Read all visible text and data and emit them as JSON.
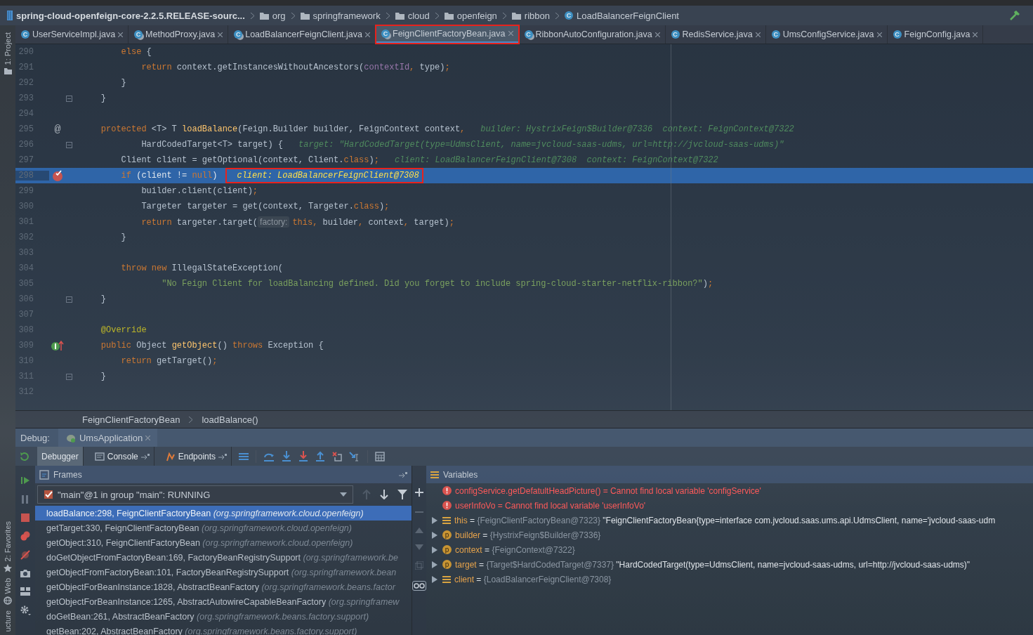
{
  "navbar": {
    "project": "spring-cloud-openfeign-core-2.2.5.RELEASE-sourc...",
    "crumbs": [
      {
        "kind": "folder",
        "label": "org"
      },
      {
        "kind": "folder",
        "label": "springframework"
      },
      {
        "kind": "folder",
        "label": "cloud"
      },
      {
        "kind": "folder",
        "label": "openfeign"
      },
      {
        "kind": "folder",
        "label": "ribbon"
      },
      {
        "kind": "class",
        "letter": "C",
        "label": "LoadBalancerFeignClient"
      }
    ]
  },
  "left_strip": [
    {
      "label": "1: Project"
    },
    {
      "label": "2: Favorites"
    },
    {
      "label": "Web"
    },
    {
      "label": "ucture"
    }
  ],
  "tabs": [
    {
      "letter": "C",
      "label": "UserServiceImpl.java",
      "locked": false,
      "selected": false,
      "marked": false
    },
    {
      "letter": "C",
      "label": "MethodProxy.java",
      "locked": true,
      "selected": false,
      "marked": false
    },
    {
      "letter": "C",
      "label": "LoadBalancerFeignClient.java",
      "locked": true,
      "selected": false,
      "marked": false
    },
    {
      "letter": "C",
      "label": "FeignClientFactoryBean.java",
      "locked": true,
      "selected": true,
      "marked": true
    },
    {
      "letter": "C",
      "label": "RibbonAutoConfiguration.java",
      "locked": true,
      "selected": false,
      "marked": false
    },
    {
      "letter": "C",
      "label": "RedisService.java",
      "locked": false,
      "selected": false,
      "marked": false
    },
    {
      "letter": "C",
      "label": "UmsConfigService.java",
      "locked": false,
      "selected": false,
      "marked": false
    },
    {
      "letter": "C",
      "label": "FeignConfig.java",
      "locked": false,
      "selected": false,
      "marked": false
    }
  ],
  "editor": {
    "lines": [
      {
        "number": "290",
        "tokens": [
          {
            "kind": "keyword",
            "text": "        else"
          },
          {
            "kind": "plain",
            "text": " {"
          }
        ]
      },
      {
        "number": "291",
        "tokens": [
          {
            "kind": "keyword",
            "text": "            return"
          },
          {
            "kind": "plain",
            "text": " context.getInstancesWithoutAncestors("
          },
          {
            "kind": "field",
            "text": "contextId"
          },
          {
            "kind": "keyword",
            "text": ","
          },
          {
            "kind": "plain",
            "text": " type)"
          },
          {
            "kind": "keyword",
            "text": ";"
          }
        ]
      },
      {
        "number": "292",
        "tokens": [
          {
            "kind": "plain",
            "text": "        }"
          }
        ]
      },
      {
        "number": "293",
        "fold": true,
        "tokens": [
          {
            "kind": "plain",
            "text": "    }"
          }
        ]
      },
      {
        "number": "294"
      },
      {
        "number": "295",
        "marker": {
          "kind": "annotation",
          "glyph": "@"
        },
        "tokens": [
          {
            "kind": "keyword",
            "text": "    protected"
          },
          {
            "kind": "plain",
            "text": " <T> T "
          },
          {
            "kind": "function",
            "text": "loadBalance"
          },
          {
            "kind": "plain",
            "text": "(Feign.Builder builder, FeignContext context"
          },
          {
            "kind": "keyword",
            "text": ","
          }
        ],
        "hint": "builder: HystrixFeign$Builder@7336  context: FeignContext@7322"
      },
      {
        "number": "296",
        "fold": true,
        "tokens": [
          {
            "kind": "plain",
            "text": "            HardCodedTarget<T> target) {"
          }
        ],
        "hint": "target: \"HardCodedTarget(type=UdmsClient, name=jvcloud-saas-udms, url=http://jvcloud-saas-udms)\""
      },
      {
        "number": "297",
        "tokens": [
          {
            "kind": "plain",
            "text": "        Client client = getOptional(context, Client."
          },
          {
            "kind": "keyword",
            "text": "class"
          },
          {
            "kind": "plain",
            "text": ")"
          },
          {
            "kind": "keyword",
            "text": ";"
          }
        ],
        "hint": "client: LoadBalancerFeignClient@7308  context: FeignContext@7322"
      },
      {
        "number": "298",
        "current": true,
        "marker": {
          "kind": "breakpoint"
        },
        "tokens": [
          {
            "kind": "keyword",
            "text": "        if"
          },
          {
            "kind": "plain",
            "text": " (client != "
          },
          {
            "kind": "keyword",
            "text": "null"
          },
          {
            "kind": "plain",
            "text": ")"
          }
        ],
        "value": "client: LoadBalancerFeignClient@7308"
      },
      {
        "number": "299",
        "tokens": [
          {
            "kind": "plain",
            "text": "            builder.client(client)"
          },
          {
            "kind": "keyword",
            "text": ";"
          }
        ]
      },
      {
        "number": "300",
        "tokens": [
          {
            "kind": "plain",
            "text": "            Targeter targeter = get(context, Targeter."
          },
          {
            "kind": "keyword",
            "text": "class"
          },
          {
            "kind": "plain",
            "text": ")"
          },
          {
            "kind": "keyword",
            "text": ";"
          }
        ]
      },
      {
        "number": "301",
        "tokens": [
          {
            "kind": "keyword",
            "text": "            return"
          },
          {
            "kind": "plain",
            "text": " targeter.target("
          },
          {
            "kind": "param_hint",
            "text": "factory:"
          },
          {
            "kind": "keyword",
            "text": "this,"
          },
          {
            "kind": "plain",
            "text": " builder"
          },
          {
            "kind": "keyword",
            "text": ","
          },
          {
            "kind": "plain",
            "text": " context"
          },
          {
            "kind": "keyword",
            "text": ","
          },
          {
            "kind": "plain",
            "text": " target)"
          },
          {
            "kind": "keyword",
            "text": ";"
          }
        ]
      },
      {
        "number": "302",
        "tokens": [
          {
            "kind": "plain",
            "text": "        }"
          }
        ]
      },
      {
        "number": "303"
      },
      {
        "number": "304",
        "tokens": [
          {
            "kind": "keyword",
            "text": "        throw new"
          },
          {
            "kind": "plain",
            "text": " IllegalStateException("
          }
        ]
      },
      {
        "number": "305",
        "tokens": [
          {
            "kind": "string",
            "text": "                \"No Feign Client for loadBalancing defined. Did you forget to include spring-cloud-starter-netflix-ribbon?\""
          },
          {
            "kind": "plain",
            "text": ")"
          },
          {
            "kind": "keyword",
            "text": ";"
          }
        ]
      },
      {
        "number": "306",
        "fold": true,
        "tokens": [
          {
            "kind": "plain",
            "text": "    }"
          }
        ]
      },
      {
        "number": "307"
      },
      {
        "number": "308",
        "tokens": [
          {
            "kind": "annotation",
            "text": "    @Override"
          }
        ]
      },
      {
        "number": "309",
        "marker": {
          "kind": "implements"
        },
        "tokens": [
          {
            "kind": "keyword",
            "text": "    public"
          },
          {
            "kind": "plain",
            "text": " Object "
          },
          {
            "kind": "function",
            "text": "getObject"
          },
          {
            "kind": "plain",
            "text": "() "
          },
          {
            "kind": "keyword",
            "text": "throws"
          },
          {
            "kind": "plain",
            "text": " Exception {"
          }
        ]
      },
      {
        "number": "310",
        "tokens": [
          {
            "kind": "keyword",
            "text": "        return"
          },
          {
            "kind": "plain",
            "text": " getTarget()"
          },
          {
            "kind": "keyword",
            "text": ";"
          }
        ]
      },
      {
        "number": "311",
        "fold": true,
        "tokens": [
          {
            "kind": "plain",
            "text": "    }"
          }
        ]
      },
      {
        "number": "312"
      }
    ],
    "breadcrumb": [
      "FeignClientFactoryBean",
      "loadBalance()"
    ]
  },
  "debug": {
    "label": "Debug:",
    "session": "UmsApplication",
    "tabs": [
      {
        "label": "Debugger",
        "selected": true,
        "pinnable": false
      },
      {
        "label": "Console",
        "selected": false,
        "pinnable": true
      },
      {
        "label": "Endpoints",
        "selected": false,
        "pinnable": true
      }
    ],
    "frames": {
      "title": "Frames",
      "thread": "\"main\"@1 in group \"main\": RUNNING",
      "rows": [
        {
          "method": "loadBalance:298, FeignClientFactoryBean",
          "package": "(org.springframework.cloud.openfeign)",
          "selected": true
        },
        {
          "method": "getTarget:330, FeignClientFactoryBean",
          "package": "(org.springframework.cloud.openfeign)",
          "selected": false
        },
        {
          "method": "getObject:310, FeignClientFactoryBean",
          "package": "(org.springframework.cloud.openfeign)",
          "selected": false
        },
        {
          "method": "doGetObjectFromFactoryBean:169, FactoryBeanRegistrySupport",
          "package": "(org.springframework.be",
          "selected": false
        },
        {
          "method": "getObjectFromFactoryBean:101, FactoryBeanRegistrySupport",
          "package": "(org.springframework.bean",
          "selected": false
        },
        {
          "method": "getObjectForBeanInstance:1828, AbstractBeanFactory",
          "package": "(org.springframework.beans.factor",
          "selected": false
        },
        {
          "method": "getObjectForBeanInstance:1265, AbstractAutowireCapableBeanFactory",
          "package": "(org.springframew",
          "selected": false
        },
        {
          "method": "doGetBean:261, AbstractBeanFactory",
          "package": "(org.springframework.beans.factory.support)",
          "selected": false
        },
        {
          "method": "getBean:202, AbstractBeanFactory",
          "package": "(org.springframework.beans.factory.support)",
          "selected": false
        }
      ]
    },
    "variables": {
      "title": "Variables",
      "rows": [
        {
          "kind": "error",
          "sign": "=",
          "name": "configService.getDefatultHeadPicture()",
          "value": "Cannot find local variable 'configService'"
        },
        {
          "kind": "error",
          "sign": "=",
          "name": "userInfoVo",
          "value": "Cannot find local variable 'userInfoVo'"
        },
        {
          "kind": "field",
          "sign": "=",
          "name": "this",
          "ref": "{FeignClientFactoryBean@7323}",
          "text": "\"FeignClientFactoryBean{type=interface com.jvcloud.saas.ums.api.UdmsClient, name='jvcloud-saas-udm"
        },
        {
          "kind": "param",
          "badge": "p",
          "sign": "=",
          "name": "builder",
          "ref": "{HystrixFeign$Builder@7336}"
        },
        {
          "kind": "param",
          "badge": "p",
          "sign": "=",
          "name": "context",
          "ref": "{FeignContext@7322}"
        },
        {
          "kind": "param",
          "badge": "p",
          "sign": "=",
          "name": "target",
          "ref": "{Target$HardCodedTarget@7337}",
          "text": "\"HardCodedTarget(type=UdmsClient, name=jvcloud-saas-udms, url=http://jvcloud-saas-udms)\""
        },
        {
          "kind": "field",
          "sign": "=",
          "name": "client",
          "ref": "{LoadBalancerFeignClient@7308}"
        }
      ]
    }
  }
}
